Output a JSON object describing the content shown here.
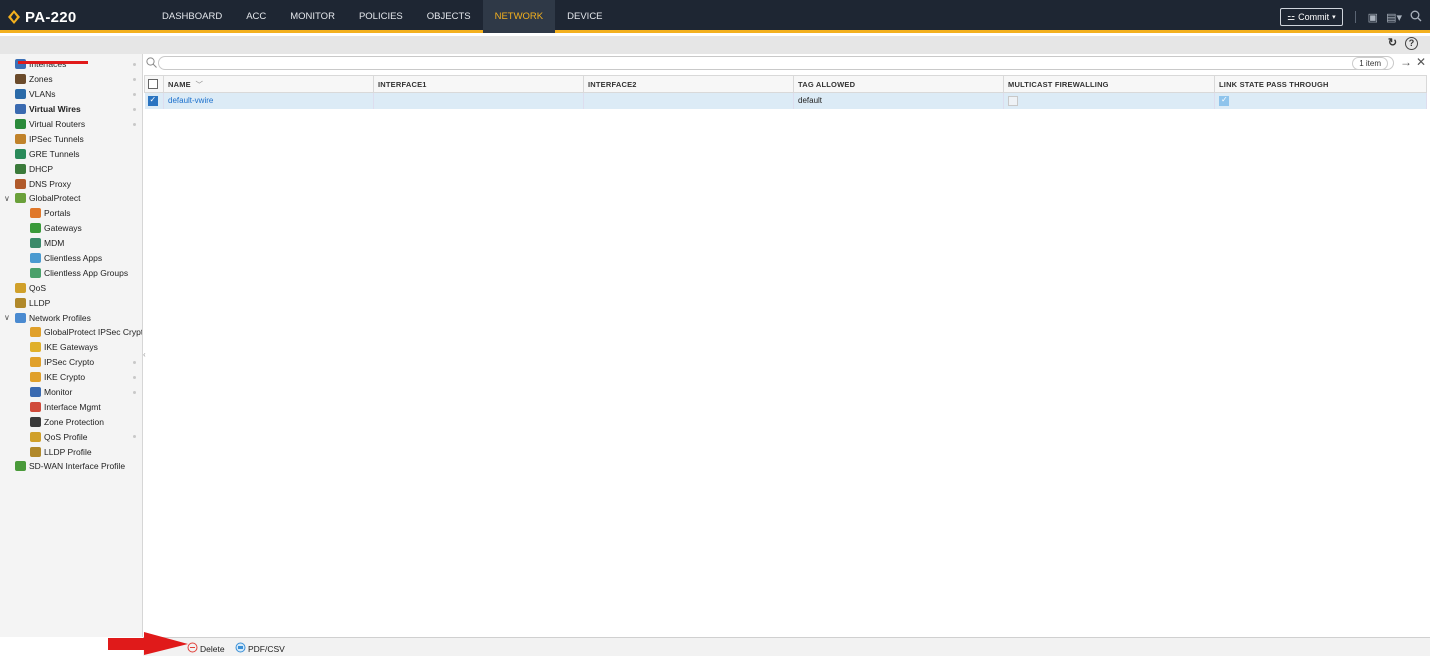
{
  "app": {
    "title": "PA-220"
  },
  "nav": {
    "tabs": [
      "DASHBOARD",
      "ACC",
      "MONITOR",
      "POLICIES",
      "OBJECTS",
      "NETWORK",
      "DEVICE"
    ],
    "active": "NETWORK"
  },
  "header": {
    "commit_label": "Commit"
  },
  "sidebar": {
    "items": [
      {
        "label": "Interfaces"
      },
      {
        "label": "Zones"
      },
      {
        "label": "VLANs"
      },
      {
        "label": "Virtual Wires"
      },
      {
        "label": "Virtual Routers"
      },
      {
        "label": "IPSec Tunnels"
      },
      {
        "label": "GRE Tunnels"
      },
      {
        "label": "DHCP"
      },
      {
        "label": "DNS Proxy"
      },
      {
        "label": "GlobalProtect"
      },
      {
        "label": "Portals"
      },
      {
        "label": "Gateways"
      },
      {
        "label": "MDM"
      },
      {
        "label": "Clientless Apps"
      },
      {
        "label": "Clientless App Groups"
      },
      {
        "label": "QoS"
      },
      {
        "label": "LLDP"
      },
      {
        "label": "Network Profiles"
      },
      {
        "label": "GlobalProtect IPSec Crypto"
      },
      {
        "label": "IKE Gateways"
      },
      {
        "label": "IPSec Crypto"
      },
      {
        "label": "IKE Crypto"
      },
      {
        "label": "Monitor"
      },
      {
        "label": "Interface Mgmt"
      },
      {
        "label": "Zone Protection"
      },
      {
        "label": "QoS Profile"
      },
      {
        "label": "LLDP Profile"
      },
      {
        "label": "SD-WAN Interface Profile"
      }
    ],
    "selected": "Virtual Wires"
  },
  "search": {
    "placeholder": "",
    "count": "1 item"
  },
  "table": {
    "columns": [
      "NAME",
      "INTERFACE1",
      "INTERFACE2",
      "TAG ALLOWED",
      "MULTICAST FIREWALLING",
      "LINK STATE PASS THROUGH"
    ],
    "rows": [
      {
        "name": "default-vwire",
        "interface1": "",
        "interface2": "",
        "tag_allowed": "default",
        "multicast_firewalling": false,
        "link_state_pass_through": true,
        "selected": true
      }
    ]
  },
  "footer": {
    "delete_label": "Delete",
    "export_label": "PDF/CSV"
  },
  "colors": {
    "topbar": "#1e2633",
    "accent": "#f3b01e",
    "link": "#1a6fcc",
    "selected_row": "#dcebf6",
    "annotation_red": "#e01a1a"
  }
}
